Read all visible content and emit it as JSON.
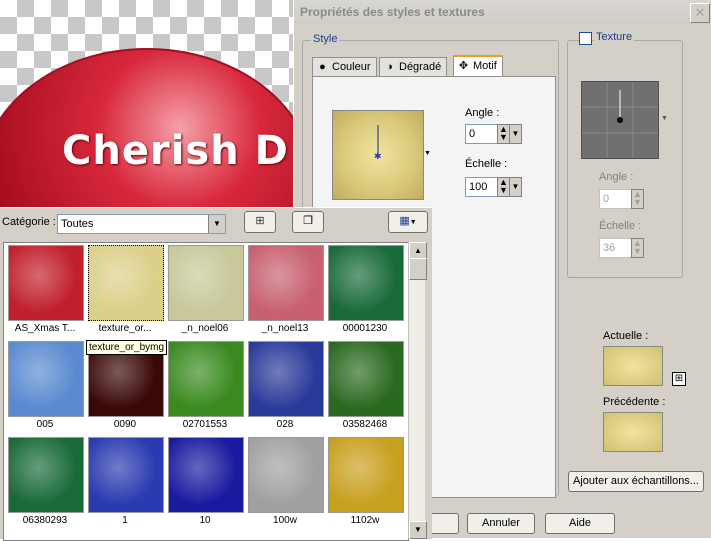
{
  "background_image": {
    "logo_text": "Cherish D S"
  },
  "dialog": {
    "title": "Propriétés des styles et textures",
    "close_glyph": "✕",
    "style_group_label": "Style",
    "tabs": [
      {
        "label": "Couleur",
        "icon": "circle-icon"
      },
      {
        "label": "Dégradé",
        "icon": "gradient-icon"
      },
      {
        "label": "Motif",
        "icon": "pattern-icon"
      }
    ],
    "active_tab": "Motif",
    "angle_label": "Angle :",
    "angle_value": "0",
    "scale_label": "Échelle :",
    "scale_value": "100",
    "texture_checkbox_label": "Texture",
    "texture_checked": false,
    "texture_angle_label": "Angle :",
    "texture_angle_value": "0",
    "texture_scale_label": "Échelle :",
    "texture_scale_value": "36",
    "current_label": "Actuelle :",
    "previous_label": "Précédente :",
    "add_swatch_button": "Ajouter aux échantillons...",
    "cancel_button": "Annuler",
    "help_button": "Aide"
  },
  "palette": {
    "category_label": "Catégorie :",
    "category_value": "Toutes",
    "tooltip": "texture_or_bymg",
    "items": [
      {
        "label": "AS_Xmas T...",
        "color": "#c0202c"
      },
      {
        "label": "texture_or...",
        "color": "#dccf8a"
      },
      {
        "label": "_n_noel06",
        "color": "#c8c89a"
      },
      {
        "label": "_n_noel13",
        "color": "#c86070"
      },
      {
        "label": "00001230",
        "color": "#1a6a3a"
      },
      {
        "label": "005",
        "color": "#5a8ad0"
      },
      {
        "label": "0090",
        "color": "#3a0808"
      },
      {
        "label": "02701553",
        "color": "#3a8a20"
      },
      {
        "label": "028",
        "color": "#2a3a9a"
      },
      {
        "label": "03582468",
        "color": "#2a6a20"
      },
      {
        "label": "06380293",
        "color": "#1a6a3a"
      },
      {
        "label": "1",
        "color": "#2a3ab0"
      },
      {
        "label": "10",
        "color": "#1a1aa0"
      },
      {
        "label": "100w",
        "color": "#a0a0a0"
      },
      {
        "label": "1102w",
        "color": "#c8a020"
      }
    ]
  }
}
